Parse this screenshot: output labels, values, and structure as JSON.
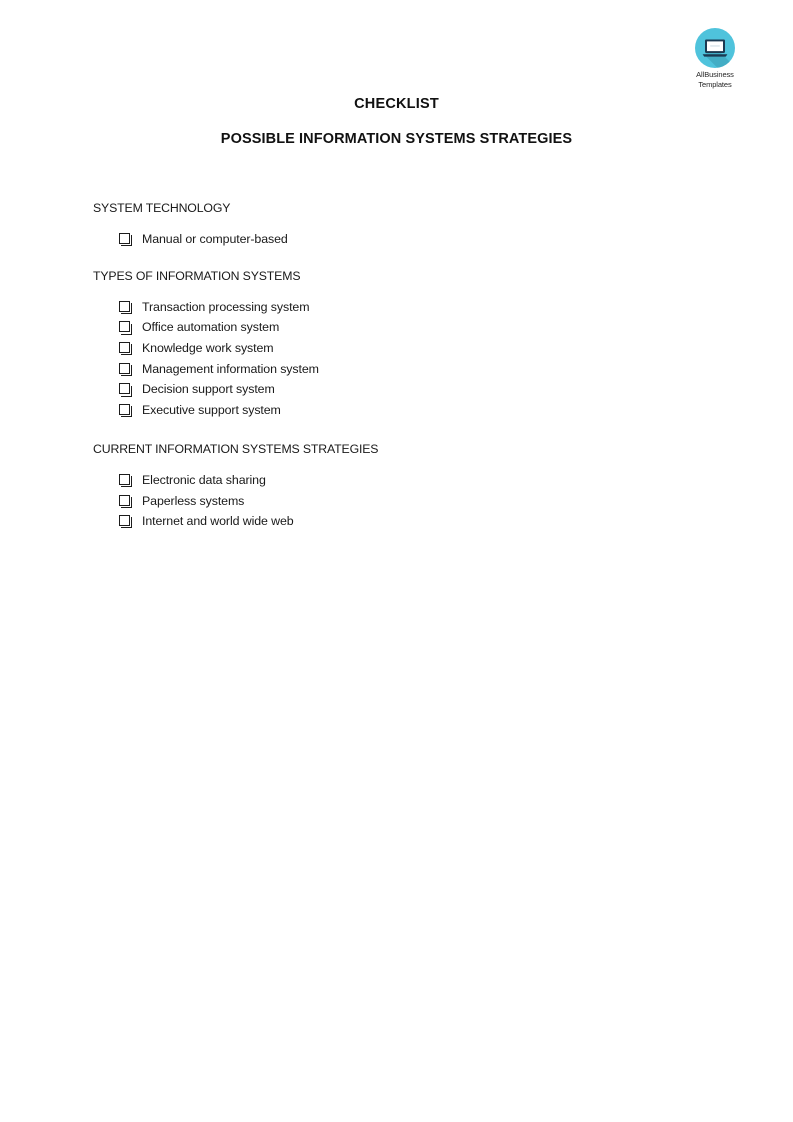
{
  "brand": {
    "logo_icon": "laptop-icon",
    "name_line1": "AllBusiness",
    "name_line2": "Templates",
    "circle_color": "#4FC3DC",
    "laptop_frame_color": "#1B3A52",
    "laptop_screen_color": "#FFFFFF"
  },
  "document": {
    "title": "CHECKLIST",
    "subtitle": "POSSIBLE INFORMATION SYSTEMS STRATEGIES"
  },
  "sections": [
    {
      "heading": "SYSTEM TECHNOLOGY",
      "items": [
        {
          "label": "Manual or computer-based",
          "checked": false
        }
      ]
    },
    {
      "heading": "TYPES OF INFORMATION SYSTEMS",
      "items": [
        {
          "label": "Transaction processing system",
          "checked": false
        },
        {
          "label": "Office automation system",
          "checked": false
        },
        {
          "label": "Knowledge work system",
          "checked": false
        },
        {
          "label": "Management information system",
          "checked": false
        },
        {
          "label": "Decision support system",
          "checked": false
        },
        {
          "label": "Executive support system",
          "checked": false
        }
      ]
    },
    {
      "heading": "CURRENT INFORMATION SYSTEMS STRATEGIES",
      "items": [
        {
          "label": "Electronic data sharing",
          "checked": false
        },
        {
          "label": "Paperless systems",
          "checked": false
        },
        {
          "label": "Internet and world wide web",
          "checked": false
        }
      ]
    }
  ]
}
